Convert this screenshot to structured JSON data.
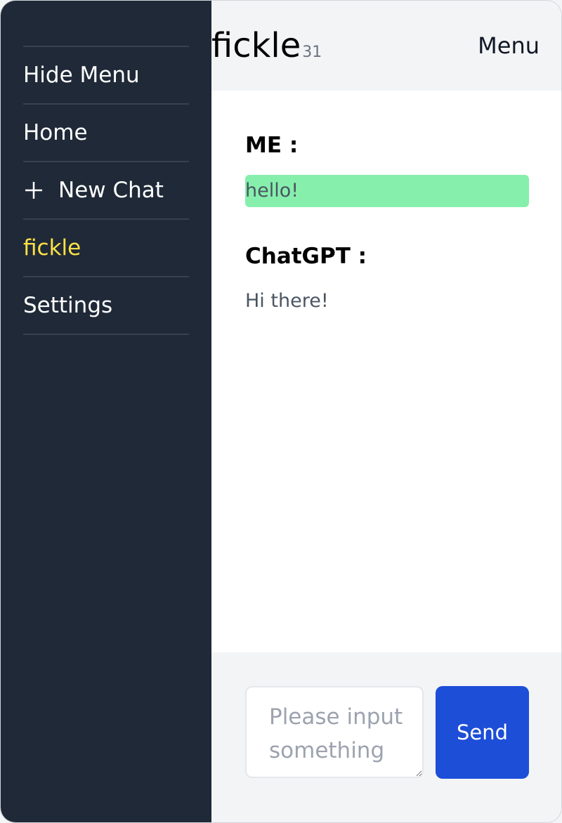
{
  "sidebar": {
    "items": [
      {
        "label": "Hide Menu"
      },
      {
        "label": "Home"
      },
      {
        "label": "New Chat",
        "icon": "plus-icon"
      },
      {
        "label": "fickle",
        "active": true
      },
      {
        "label": "Settings"
      }
    ]
  },
  "header": {
    "title": "fickle",
    "count": "31",
    "menu_label": "Menu"
  },
  "chat": {
    "messages": [
      {
        "sender": "ME :",
        "text": "hello!"
      },
      {
        "sender": "ChatGPT :",
        "text": "Hi there!"
      }
    ]
  },
  "input": {
    "value": "",
    "placeholder": "Please input something"
  },
  "send": {
    "label": "Send"
  },
  "colors": {
    "sidebar_bg": "#1f2937",
    "active_item": "#fde047",
    "user_bubble": "#86efac",
    "send_button": "#1d4ed8"
  }
}
